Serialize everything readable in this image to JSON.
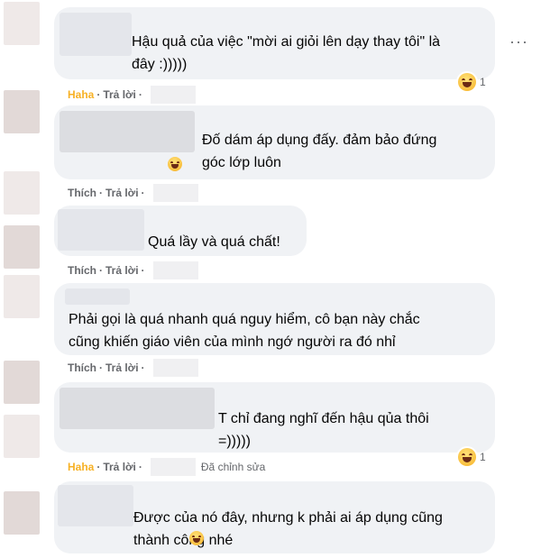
{
  "comments": [
    {
      "text": "Hậu quả của việc \"mời ai giỏi lên dạy thay tôi\" là\nđây :)))))",
      "action": "Haha",
      "reply": "Trả lời",
      "reactions": "1"
    },
    {
      "text": "Đố dám áp dụng đấy. đảm bảo đứng\ngóc lớp luôn",
      "action": "Thích",
      "reply": "Trả lời"
    },
    {
      "text": "Quá lầy và quá chất!",
      "action": "Thích",
      "reply": "Trả lời"
    },
    {
      "text": "Phải gọi là quá nhanh quá nguy hiểm, cô bạn này chắc\ncũng khiến giáo viên của mình ngớ người ra đó nhỉ",
      "action": "Thích",
      "reply": "Trả lời"
    },
    {
      "text": "T chỉ đang nghĩ đến hậu qủa thôi\n=)))))",
      "action": "Haha",
      "reply": "Trả lời",
      "edited": "Đã chỉnh sửa",
      "reactions": "1"
    },
    {
      "text": "Được của nó đây, nhưng k phải ai áp dụng cũng\nthành công nhé"
    }
  ],
  "sep": "·",
  "more_icon": "more-horizontal-icon",
  "colors": {
    "haha": "#f7b125",
    "bubble": "#f0f2f5",
    "meta": "#65676b"
  }
}
